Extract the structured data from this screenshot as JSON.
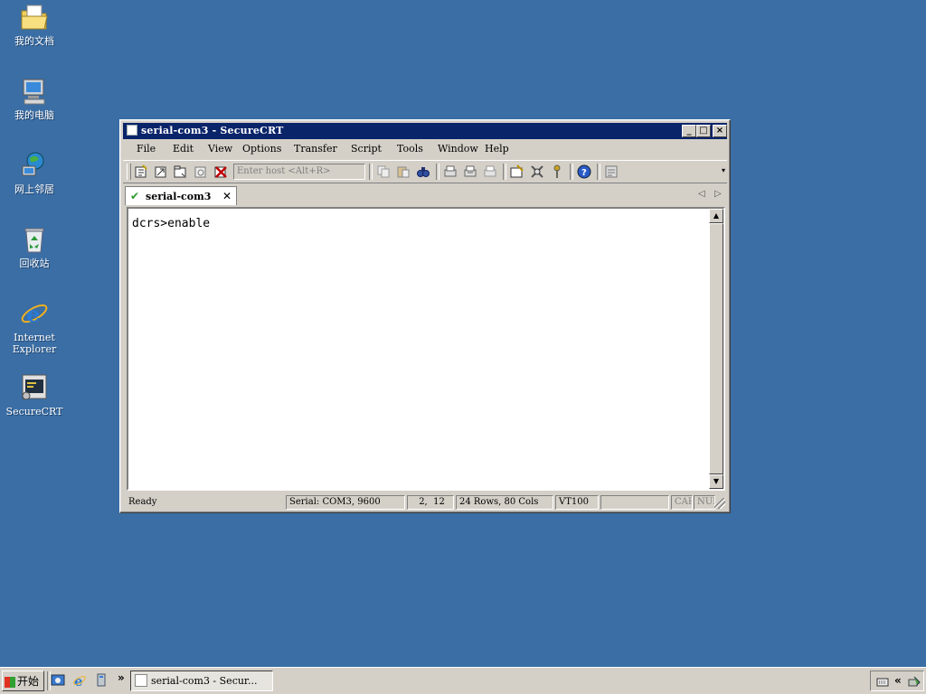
{
  "desktop": {
    "icons": [
      {
        "label": "我的文档",
        "icon": "folder-documents-icon"
      },
      {
        "label": "我的电脑",
        "icon": "my-computer-icon"
      },
      {
        "label": "网上邻居",
        "icon": "network-icon"
      },
      {
        "label": "回收站",
        "icon": "recycle-bin-icon"
      },
      {
        "label": "Internet Explorer",
        "icon": "internet-explorer-icon"
      },
      {
        "label": "SecureCRT",
        "icon": "securecrt-icon"
      }
    ]
  },
  "window": {
    "title": "serial-com3 - SecureCRT",
    "menu": [
      "File",
      "Edit",
      "View",
      "Options",
      "Transfer",
      "Script",
      "Tools",
      "Window",
      "Help"
    ],
    "toolbar": {
      "host_placeholder": "Enter host <Alt+R>"
    },
    "tab": {
      "label": "serial-com3"
    },
    "terminal": {
      "lines": [
        "dcrs>enable"
      ]
    },
    "status": {
      "ready": "Ready",
      "serial": "Serial: COM3, 9600",
      "cursor": "2,  12",
      "size": "24 Rows, 80 Cols",
      "emulation": "VT100",
      "cap": "CAP",
      "num": "NUM"
    }
  },
  "taskbar": {
    "start_label": "开始",
    "task_label": "serial-com3 - Secur...",
    "quicklaunch_more": "»",
    "tray_expand": "«"
  },
  "colors": {
    "desktop": "#3a6ea5",
    "titlebar": "#0a246a",
    "face": "#d4d0c8"
  }
}
